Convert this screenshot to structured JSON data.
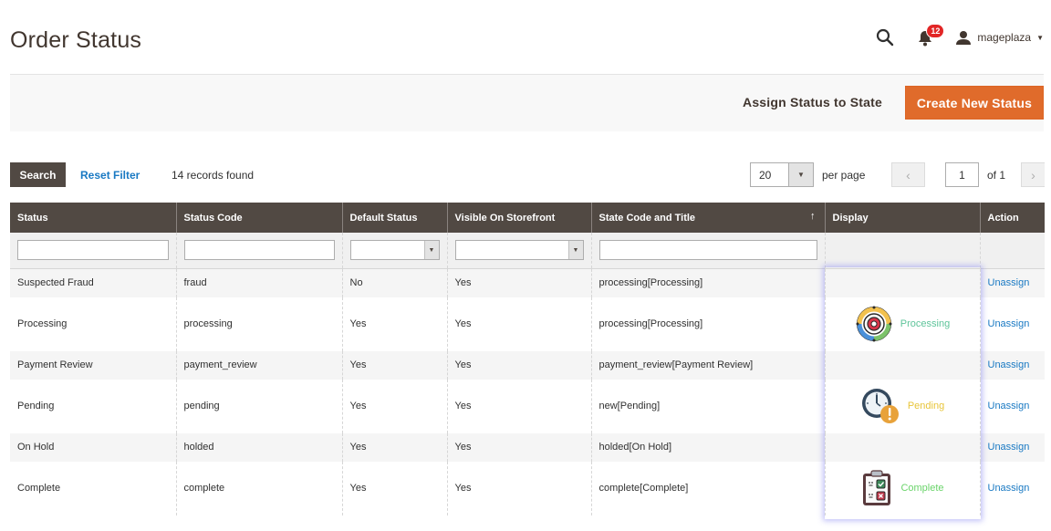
{
  "page": {
    "title": "Order Status"
  },
  "header": {
    "notifications_count": "12",
    "user_name": "mageplaza"
  },
  "actions": {
    "assign_label": "Assign Status to State",
    "create_label": "Create New Status",
    "create_color": "#e06b2b"
  },
  "toolbar": {
    "search_label": "Search",
    "reset_label": "Reset Filter",
    "records_text": "14 records found",
    "per_page_value": "20",
    "per_page_label": "per page",
    "page_value": "1",
    "page_of": "of 1"
  },
  "grid": {
    "columns": [
      "Status",
      "Status Code",
      "Default Status",
      "Visible On Storefront",
      "State Code and Title",
      "Display",
      "Action"
    ],
    "rows": [
      {
        "status": "Suspected Fraud",
        "code": "fraud",
        "default": "No",
        "visible": "Yes",
        "state": "processing[Processing]",
        "display": "",
        "action": "Unassign"
      },
      {
        "status": "Processing",
        "code": "processing",
        "default": "Yes",
        "visible": "Yes",
        "state": "processing[Processing]",
        "display": "Processing",
        "display_icon": "processing-gear-icon",
        "display_color": "#5ec49a",
        "action": "Unassign"
      },
      {
        "status": "Payment Review",
        "code": "payment_review",
        "default": "Yes",
        "visible": "Yes",
        "state": "payment_review[Payment Review]",
        "display": "",
        "action": "Unassign"
      },
      {
        "status": "Pending",
        "code": "pending",
        "default": "Yes",
        "visible": "Yes",
        "state": "new[Pending]",
        "display": "Pending",
        "display_icon": "clock-warning-icon",
        "display_color": "#e8c53a",
        "action": "Unassign"
      },
      {
        "status": "On Hold",
        "code": "holded",
        "default": "Yes",
        "visible": "Yes",
        "state": "holded[On Hold]",
        "display": "",
        "action": "Unassign"
      },
      {
        "status": "Complete",
        "code": "complete",
        "default": "Yes",
        "visible": "Yes",
        "state": "complete[Complete]",
        "display": "Complete",
        "display_icon": "clipboard-check-icon",
        "display_color": "#6ad46a",
        "action": "Unassign"
      }
    ]
  }
}
